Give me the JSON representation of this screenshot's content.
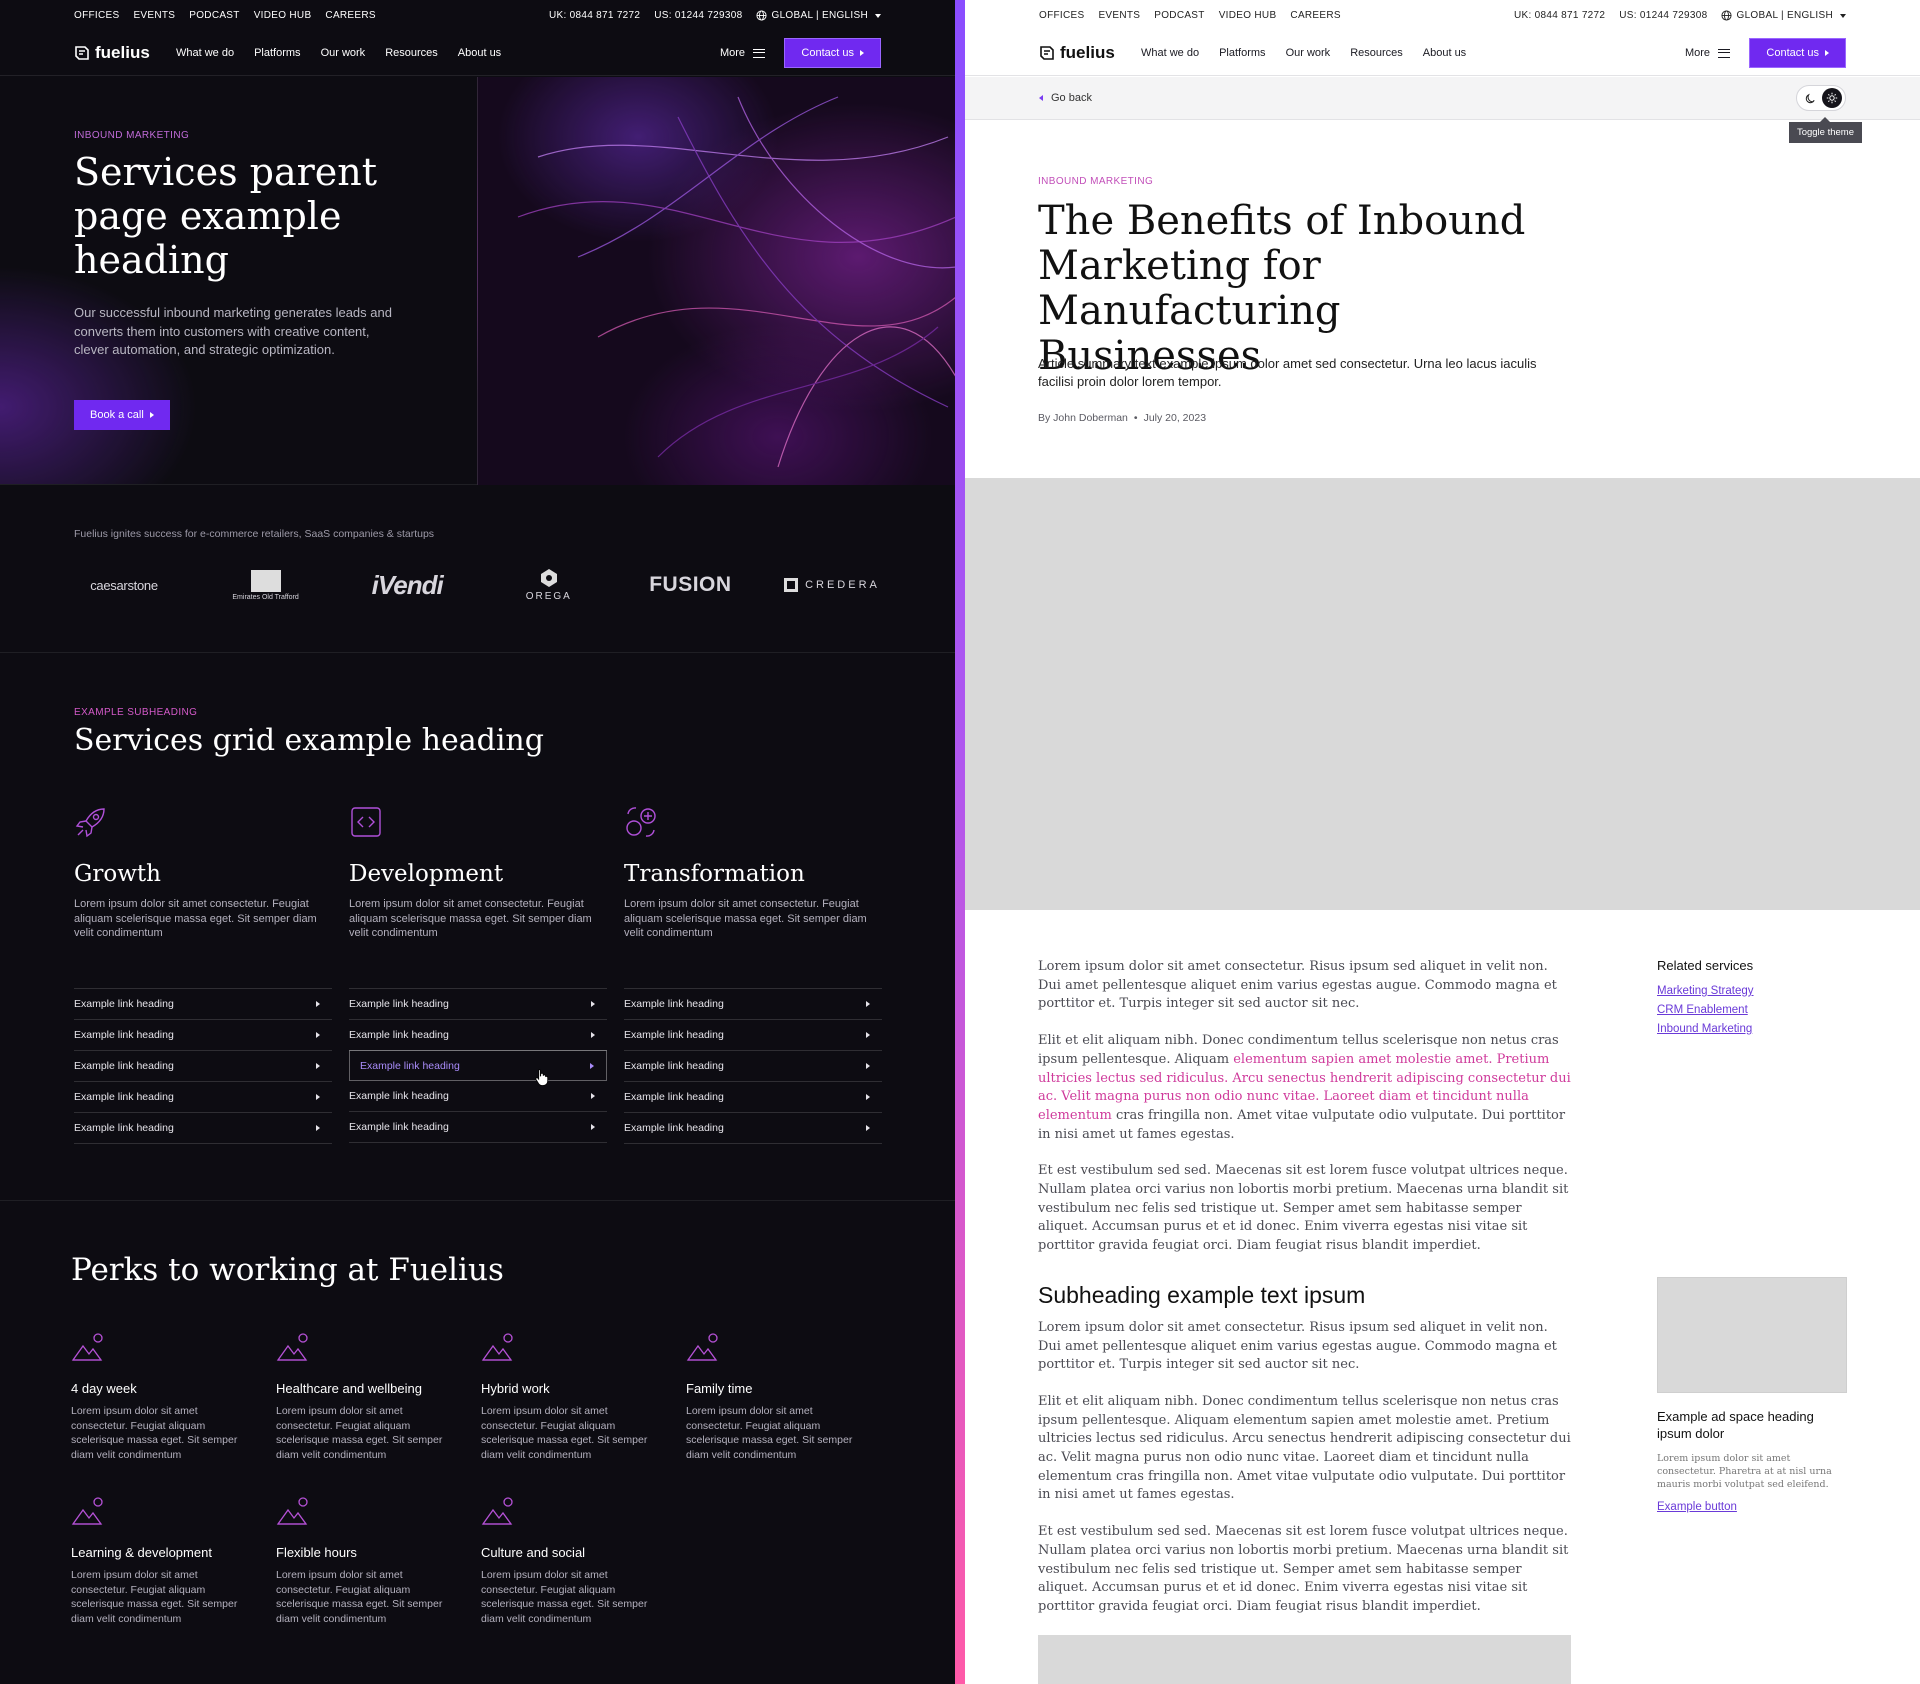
{
  "colors": {
    "accent": "#7029f0",
    "eyebrow_pink": "#c24fb9",
    "link_purple": "#6a3ad8",
    "divider": "#b057ef",
    "dark_bg": "#0d0c12"
  },
  "topbar": {
    "links": [
      "OFFICES",
      "EVENTS",
      "PODCAST",
      "VIDEO HUB",
      "CAREERS"
    ],
    "uk_phone": "UK: 0844 871 7272",
    "us_phone": "US: 01244 729308",
    "locale": "GLOBAL | ENGLISH"
  },
  "nav": {
    "logo": "fuelius",
    "items": [
      "What we do",
      "Platforms",
      "Our work",
      "Resources",
      "About us"
    ],
    "more": "More",
    "contact": "Contact us"
  },
  "dark": {
    "hero": {
      "eyebrow": "INBOUND MARKETING",
      "title": "Services parent page example heading",
      "description": "Our successful inbound marketing generates leads and converts them into customers with creative content, clever automation, and strategic optimization.",
      "button": "Book a call"
    },
    "clients": {
      "caption": "Fuelius ignites success for e-commerce retailers, SaaS companies & startups",
      "logos": [
        "caesarstone",
        "Emirates Old Trafford",
        "iVendi",
        "OREGA",
        "FUSION",
        "CREDERA"
      ]
    },
    "services": {
      "eyebrow": "EXAMPLE SUBHEADING",
      "title": "Services grid example heading",
      "columns": [
        {
          "icon": "rocket-icon",
          "title": "Growth",
          "text": "Lorem ipsum dolor sit amet consectetur. Feugiat aliquam scelerisque massa eget. Sit semper diam velit condimentum",
          "links": [
            "Example link heading",
            "Example link heading",
            "Example link heading",
            "Example link heading",
            "Example link heading"
          ]
        },
        {
          "icon": "code-icon",
          "title": "Development",
          "text": "Lorem ipsum dolor sit amet consectetur. Feugiat aliquam scelerisque massa eget. Sit semper diam velit condimentum",
          "links": [
            "Example link heading",
            "Example link heading",
            "Example link heading",
            "Example link heading",
            "Example link heading"
          ]
        },
        {
          "icon": "transform-icon",
          "title": "Transformation",
          "text": "Lorem ipsum dolor sit amet consectetur. Feugiat aliquam scelerisque massa eget. Sit semper diam velit condimentum",
          "links": [
            "Example link heading",
            "Example link heading",
            "Example link heading",
            "Example link heading",
            "Example link heading"
          ]
        }
      ]
    },
    "perks": {
      "title": "Perks to working at Fuelius",
      "items": [
        {
          "title": "4 day week",
          "text": "Lorem ipsum dolor sit amet consectetur. Feugiat aliquam scelerisque massa eget. Sit semper diam velit condimentum"
        },
        {
          "title": "Healthcare and wellbeing",
          "text": "Lorem ipsum dolor sit amet consectetur. Feugiat aliquam scelerisque massa eget. Sit semper diam velit condimentum"
        },
        {
          "title": "Hybrid work",
          "text": "Lorem ipsum dolor sit amet consectetur. Feugiat aliquam scelerisque massa eget. Sit semper diam velit condimentum"
        },
        {
          "title": "Family time",
          "text": "Lorem ipsum dolor sit amet consectetur. Feugiat aliquam scelerisque massa eget. Sit semper diam velit condimentum"
        },
        {
          "title": "Learning & development",
          "text": "Lorem ipsum dolor sit amet consectetur. Feugiat aliquam scelerisque massa eget. Sit semper diam velit condimentum"
        },
        {
          "title": "Flexible hours",
          "text": "Lorem ipsum dolor sit amet consectetur. Feugiat aliquam scelerisque massa eget. Sit semper diam velit condimentum"
        },
        {
          "title": "Culture and social",
          "text": "Lorem ipsum dolor sit amet consectetur. Feugiat aliquam scelerisque massa eget. Sit semper diam velit condimentum"
        }
      ]
    }
  },
  "light": {
    "back": "Go back",
    "toggle_tooltip": "Toggle theme",
    "article": {
      "eyebrow": "INBOUND MARKETING",
      "title": "The Benefits of Inbound Marketing for Manufacturing Businesses",
      "summary": "Article summary text example ipsum dolor amet sed consectetur. Urna leo lacus iaculis facilisi proin dolor lorem tempor.",
      "author": "By John Doberman",
      "date": "July 20, 2023"
    },
    "body": {
      "p1": "Lorem ipsum dolor sit amet consectetur. Risus ipsum sed aliquet in velit non. Dui amet pellentesque aliquet enim varius egestas augue. Commodo magna et porttitor et. Turpis integer sit sed auctor sit nec.",
      "p2_a": "Elit et elit aliquam nibh. Donec condimentum tellus scelerisque non netus cras ipsum pellentesque. Aliquam ",
      "p2_hl": "elementum sapien amet molestie amet. Pretium ultricies lectus sed ridiculus. Arcu senectus hendrerit adipiscing consectetur dui ac. Velit magna purus non odio nunc vitae. Laoreet diam et tincidunt nulla elementum",
      "p2_b": " cras fringilla non. Amet vitae vulputate odio vulputate. Dui porttitor in nisi amet ut fames egestas.",
      "p3": "Et est vestibulum sed sed. Maecenas sit est lorem fusce volutpat ultrices neque. Nullam platea orci varius non lobortis morbi pretium. Maecenas urna blandit sit vestibulum nec felis sed tristique ut. Semper amet sem habitasse semper aliquet. Accumsan purus et et id donec. Enim viverra egestas nisi vitae sit porttitor gravida feugiat orci. Diam feugiat risus blandit imperdiet.",
      "subheading": "Subheading example text ipsum",
      "p4": "Lorem ipsum dolor sit amet consectetur. Risus ipsum sed aliquet in velit non. Dui amet pellentesque aliquet enim varius egestas augue. Commodo magna et porttitor et. Turpis integer sit sed auctor sit nec.",
      "p5": "Elit et elit aliquam nibh. Donec condimentum tellus scelerisque non netus cras ipsum pellentesque. Aliquam elementum sapien amet molestie amet. Pretium ultricies lectus sed ridiculus. Arcu senectus hendrerit adipiscing consectetur dui ac. Velit magna purus non odio nunc vitae. Laoreet diam et tincidunt nulla elementum cras fringilla non. Amet vitae vulputate odio vulputate. Dui porttitor in nisi amet ut fames egestas.",
      "p6": "Et est vestibulum sed sed. Maecenas sit est lorem fusce volutpat ultrices neque. Nullam platea orci varius non lobortis morbi pretium. Maecenas urna blandit sit vestibulum nec felis sed tristique ut. Semper amet sem habitasse semper aliquet. Accumsan purus et et id donec. Enim viverra egestas nisi vitae sit porttitor gravida feugiat orci. Diam feugiat risus blandit imperdiet."
    },
    "related": {
      "title": "Related services",
      "links": [
        "Marketing Strategy",
        "CRM Enablement",
        "Inbound Marketing"
      ]
    },
    "ad": {
      "title": "Example ad space heading ipsum dolor",
      "text": "Lorem ipsum dolor sit amet consectetur. Pharetra at at nisl urna mauris morbi volutpat sed eleifend.",
      "button": "Example button"
    }
  }
}
